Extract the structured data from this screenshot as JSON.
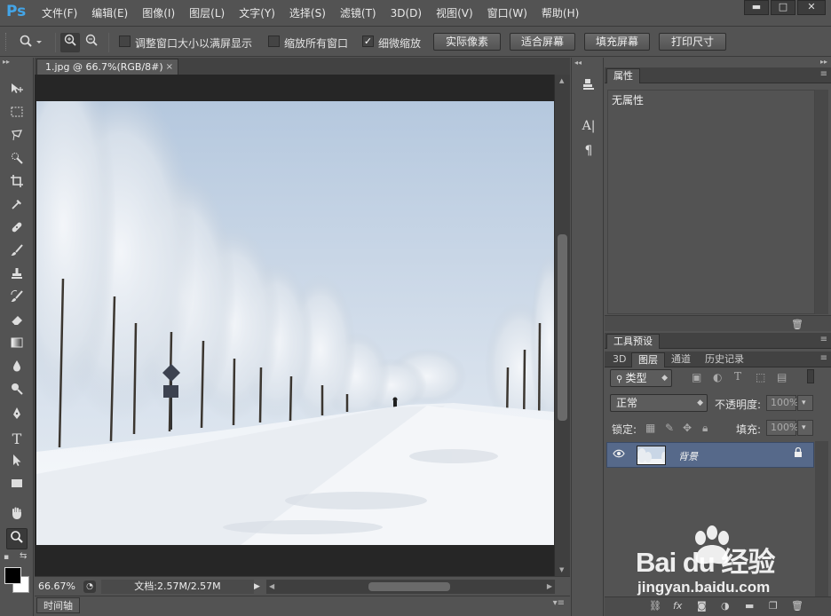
{
  "app": {
    "logo": "Ps"
  },
  "menu": [
    "文件(F)",
    "编辑(E)",
    "图像(I)",
    "图层(L)",
    "文字(Y)",
    "选择(S)",
    "滤镜(T)",
    "3D(D)",
    "视图(V)",
    "窗口(W)",
    "帮助(H)"
  ],
  "window_controls": {
    "minimize": "▬",
    "maximize": "□",
    "close": "✕"
  },
  "options": {
    "resize_windows_label": "调整窗口大小以满屏显示",
    "resize_windows_checked": false,
    "zoom_all_windows_label": "缩放所有窗口",
    "zoom_all_windows_checked": false,
    "scrubby_zoom_label": "细微缩放",
    "scrubby_zoom_checked": true,
    "btn_actual_pixels": "实际像素",
    "btn_fit_screen": "适合屏幕",
    "btn_fill_screen": "填充屏幕",
    "btn_print_size": "打印尺寸"
  },
  "document": {
    "tab_title": "1.jpg @ 66.7%(RGB/8#)",
    "tab_close": "×"
  },
  "status": {
    "zoom": "66.67%",
    "doc_info": "文档:2.57M/2.57M"
  },
  "timeline_tab": "时间轴",
  "properties_panel": {
    "tab": "属性",
    "content": "无属性"
  },
  "tool_presets_panel": {
    "tab": "工具预设"
  },
  "layers_panel": {
    "tabs": [
      "3D",
      "图层",
      "通道",
      "历史记录"
    ],
    "active_tab": "图层",
    "filter_kind": "类型",
    "blend_mode": "正常",
    "opacity_label": "不透明度:",
    "opacity_value": "100%",
    "lock_label": "锁定:",
    "fill_label": "填充:",
    "fill_value": "100%",
    "layers": [
      {
        "name": "背景",
        "visible": true,
        "locked": true
      }
    ]
  },
  "watermark": {
    "brand": "Bai du 经验",
    "url": "jingyan.baidu.com"
  },
  "icons": {
    "tools": [
      "move-icon",
      "marquee-icon",
      "lasso-icon",
      "quick-select-icon",
      "crop-icon",
      "eyedropper-icon",
      "healing-icon",
      "brush-icon",
      "stamp-icon",
      "history-brush-icon",
      "eraser-icon",
      "gradient-icon",
      "blur-icon",
      "dodge-icon",
      "pen-icon",
      "type-icon",
      "path-select-icon",
      "shape-icon",
      "hand-icon",
      "zoom-icon"
    ],
    "active_tool": "zoom-icon"
  }
}
